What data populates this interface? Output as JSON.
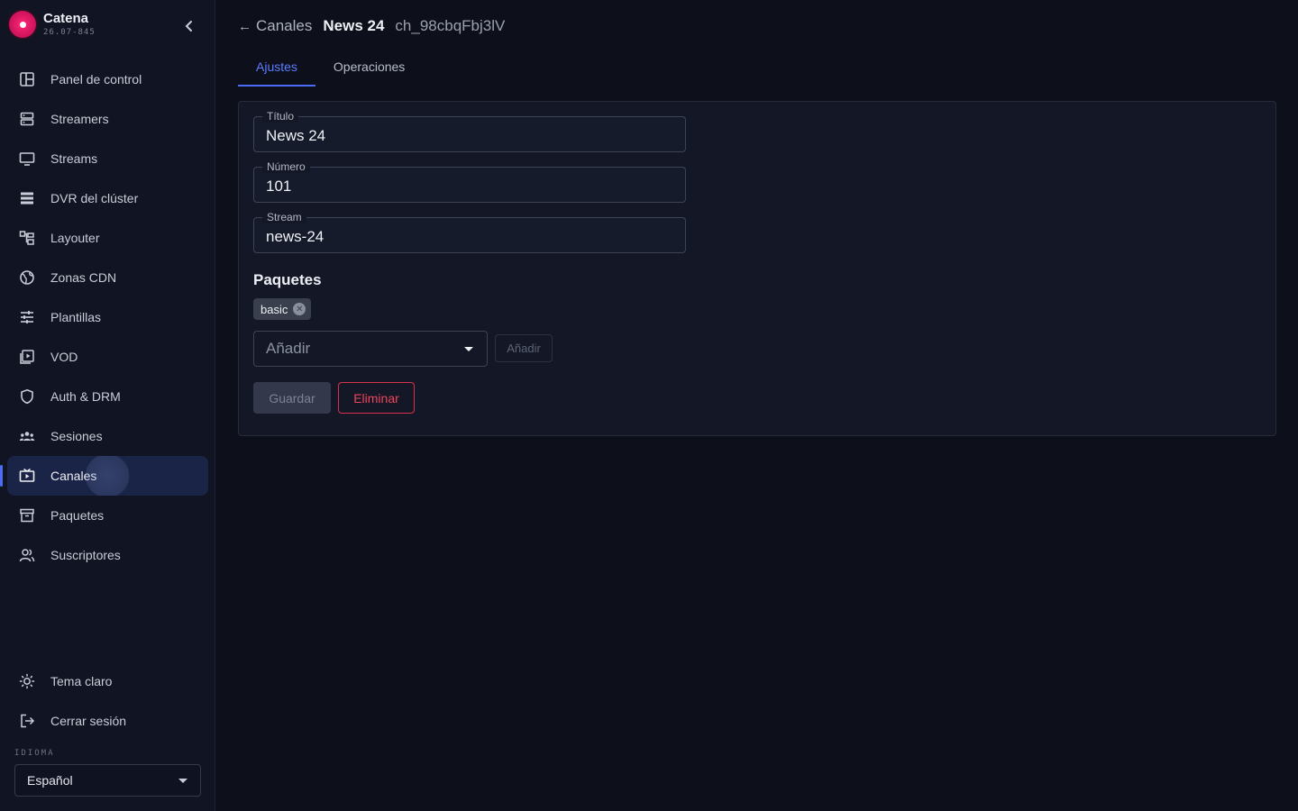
{
  "brand": {
    "name": "Catena",
    "version": "26.07-845"
  },
  "sidebar": {
    "items": [
      {
        "label": "Panel de control",
        "icon": "dashboard-icon"
      },
      {
        "label": "Streamers",
        "icon": "server-icon"
      },
      {
        "label": "Streams",
        "icon": "monitor-icon"
      },
      {
        "label": "DVR del clúster",
        "icon": "storage-icon"
      },
      {
        "label": "Layouter",
        "icon": "layout-icon"
      },
      {
        "label": "Zonas CDN",
        "icon": "globe-icon"
      },
      {
        "label": "Plantillas",
        "icon": "sliders-icon"
      },
      {
        "label": "VOD",
        "icon": "video-library-icon"
      },
      {
        "label": "Auth & DRM",
        "icon": "shield-icon"
      },
      {
        "label": "Sesiones",
        "icon": "group-icon"
      },
      {
        "label": "Canales",
        "icon": "tv-icon",
        "active": true
      },
      {
        "label": "Paquetes",
        "icon": "archive-icon"
      },
      {
        "label": "Suscriptores",
        "icon": "users-icon"
      }
    ],
    "bottom": [
      {
        "label": "Tema claro",
        "icon": "sun-icon"
      },
      {
        "label": "Cerrar sesión",
        "icon": "logout-icon"
      }
    ],
    "language_label": "IDIOMA",
    "language_value": "Español"
  },
  "breadcrumb": {
    "back": "Canales",
    "title": "News 24",
    "id": "ch_98cbqFbj3lV"
  },
  "tabs": [
    {
      "label": "Ajustes",
      "active": true
    },
    {
      "label": "Operaciones"
    }
  ],
  "form": {
    "title_label": "Título",
    "title_value": "News 24",
    "number_label": "Número",
    "number_value": "101",
    "stream_label": "Stream",
    "stream_value": "news-24",
    "packages_title": "Paquetes",
    "packages": [
      "basic"
    ],
    "add_placeholder": "Añadir",
    "add_button": "Añadir",
    "save_button": "Guardar",
    "delete_button": "Eliminar"
  },
  "colors": {
    "accent": "#4a6cf7",
    "danger": "#f0445e",
    "brand": "#e3196a",
    "background": "#0d0f1a"
  }
}
